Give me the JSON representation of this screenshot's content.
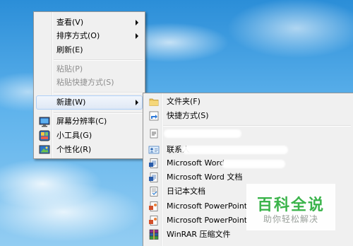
{
  "context_menu": {
    "items": [
      {
        "label": "查看(V)",
        "submenu": true,
        "enabled": true
      },
      {
        "label": "排序方式(O)",
        "submenu": true,
        "enabled": true
      },
      {
        "label": "刷新(E)",
        "submenu": false,
        "enabled": true
      },
      {
        "label": "粘贴(P)",
        "submenu": false,
        "enabled": false
      },
      {
        "label": "粘贴快捷方式(S)",
        "submenu": false,
        "enabled": false
      },
      {
        "label": "新建(W)",
        "submenu": true,
        "enabled": true,
        "highlighted": true
      },
      {
        "label": "屏幕分辨率(C)",
        "icon": "screen-resolution-icon",
        "enabled": true
      },
      {
        "label": "小工具(G)",
        "icon": "gadgets-icon",
        "enabled": true
      },
      {
        "label": "个性化(R)",
        "icon": "personalize-icon",
        "enabled": true
      }
    ]
  },
  "new_submenu": {
    "items": [
      {
        "label": "文件夹(F)",
        "icon": "folder-icon"
      },
      {
        "label": "快捷方式(S)",
        "icon": "shortcut-icon"
      },
      {
        "label": "联系人",
        "icon": "contact-icon"
      },
      {
        "label": "Microsoft Word",
        "icon": "word-doc-icon"
      },
      {
        "label": "Microsoft Word 文档",
        "icon": "word-doc-icon"
      },
      {
        "label": "日记本文档",
        "icon": "journal-doc-icon"
      },
      {
        "label": "Microsoft PowerPoint",
        "icon": "powerpoint-icon"
      },
      {
        "label": "Microsoft PowerPoint",
        "icon": "powerpoint-icon"
      },
      {
        "label": "WinRAR 压缩文件",
        "icon": "winrar-icon"
      }
    ]
  },
  "watermark": {
    "title": "百科全说",
    "subtitle": "助你轻松解决"
  },
  "colors": {
    "menu_bg": "#f0f0f0",
    "highlight_border": "#aecff7",
    "watermark_green": "#3ab34a"
  }
}
